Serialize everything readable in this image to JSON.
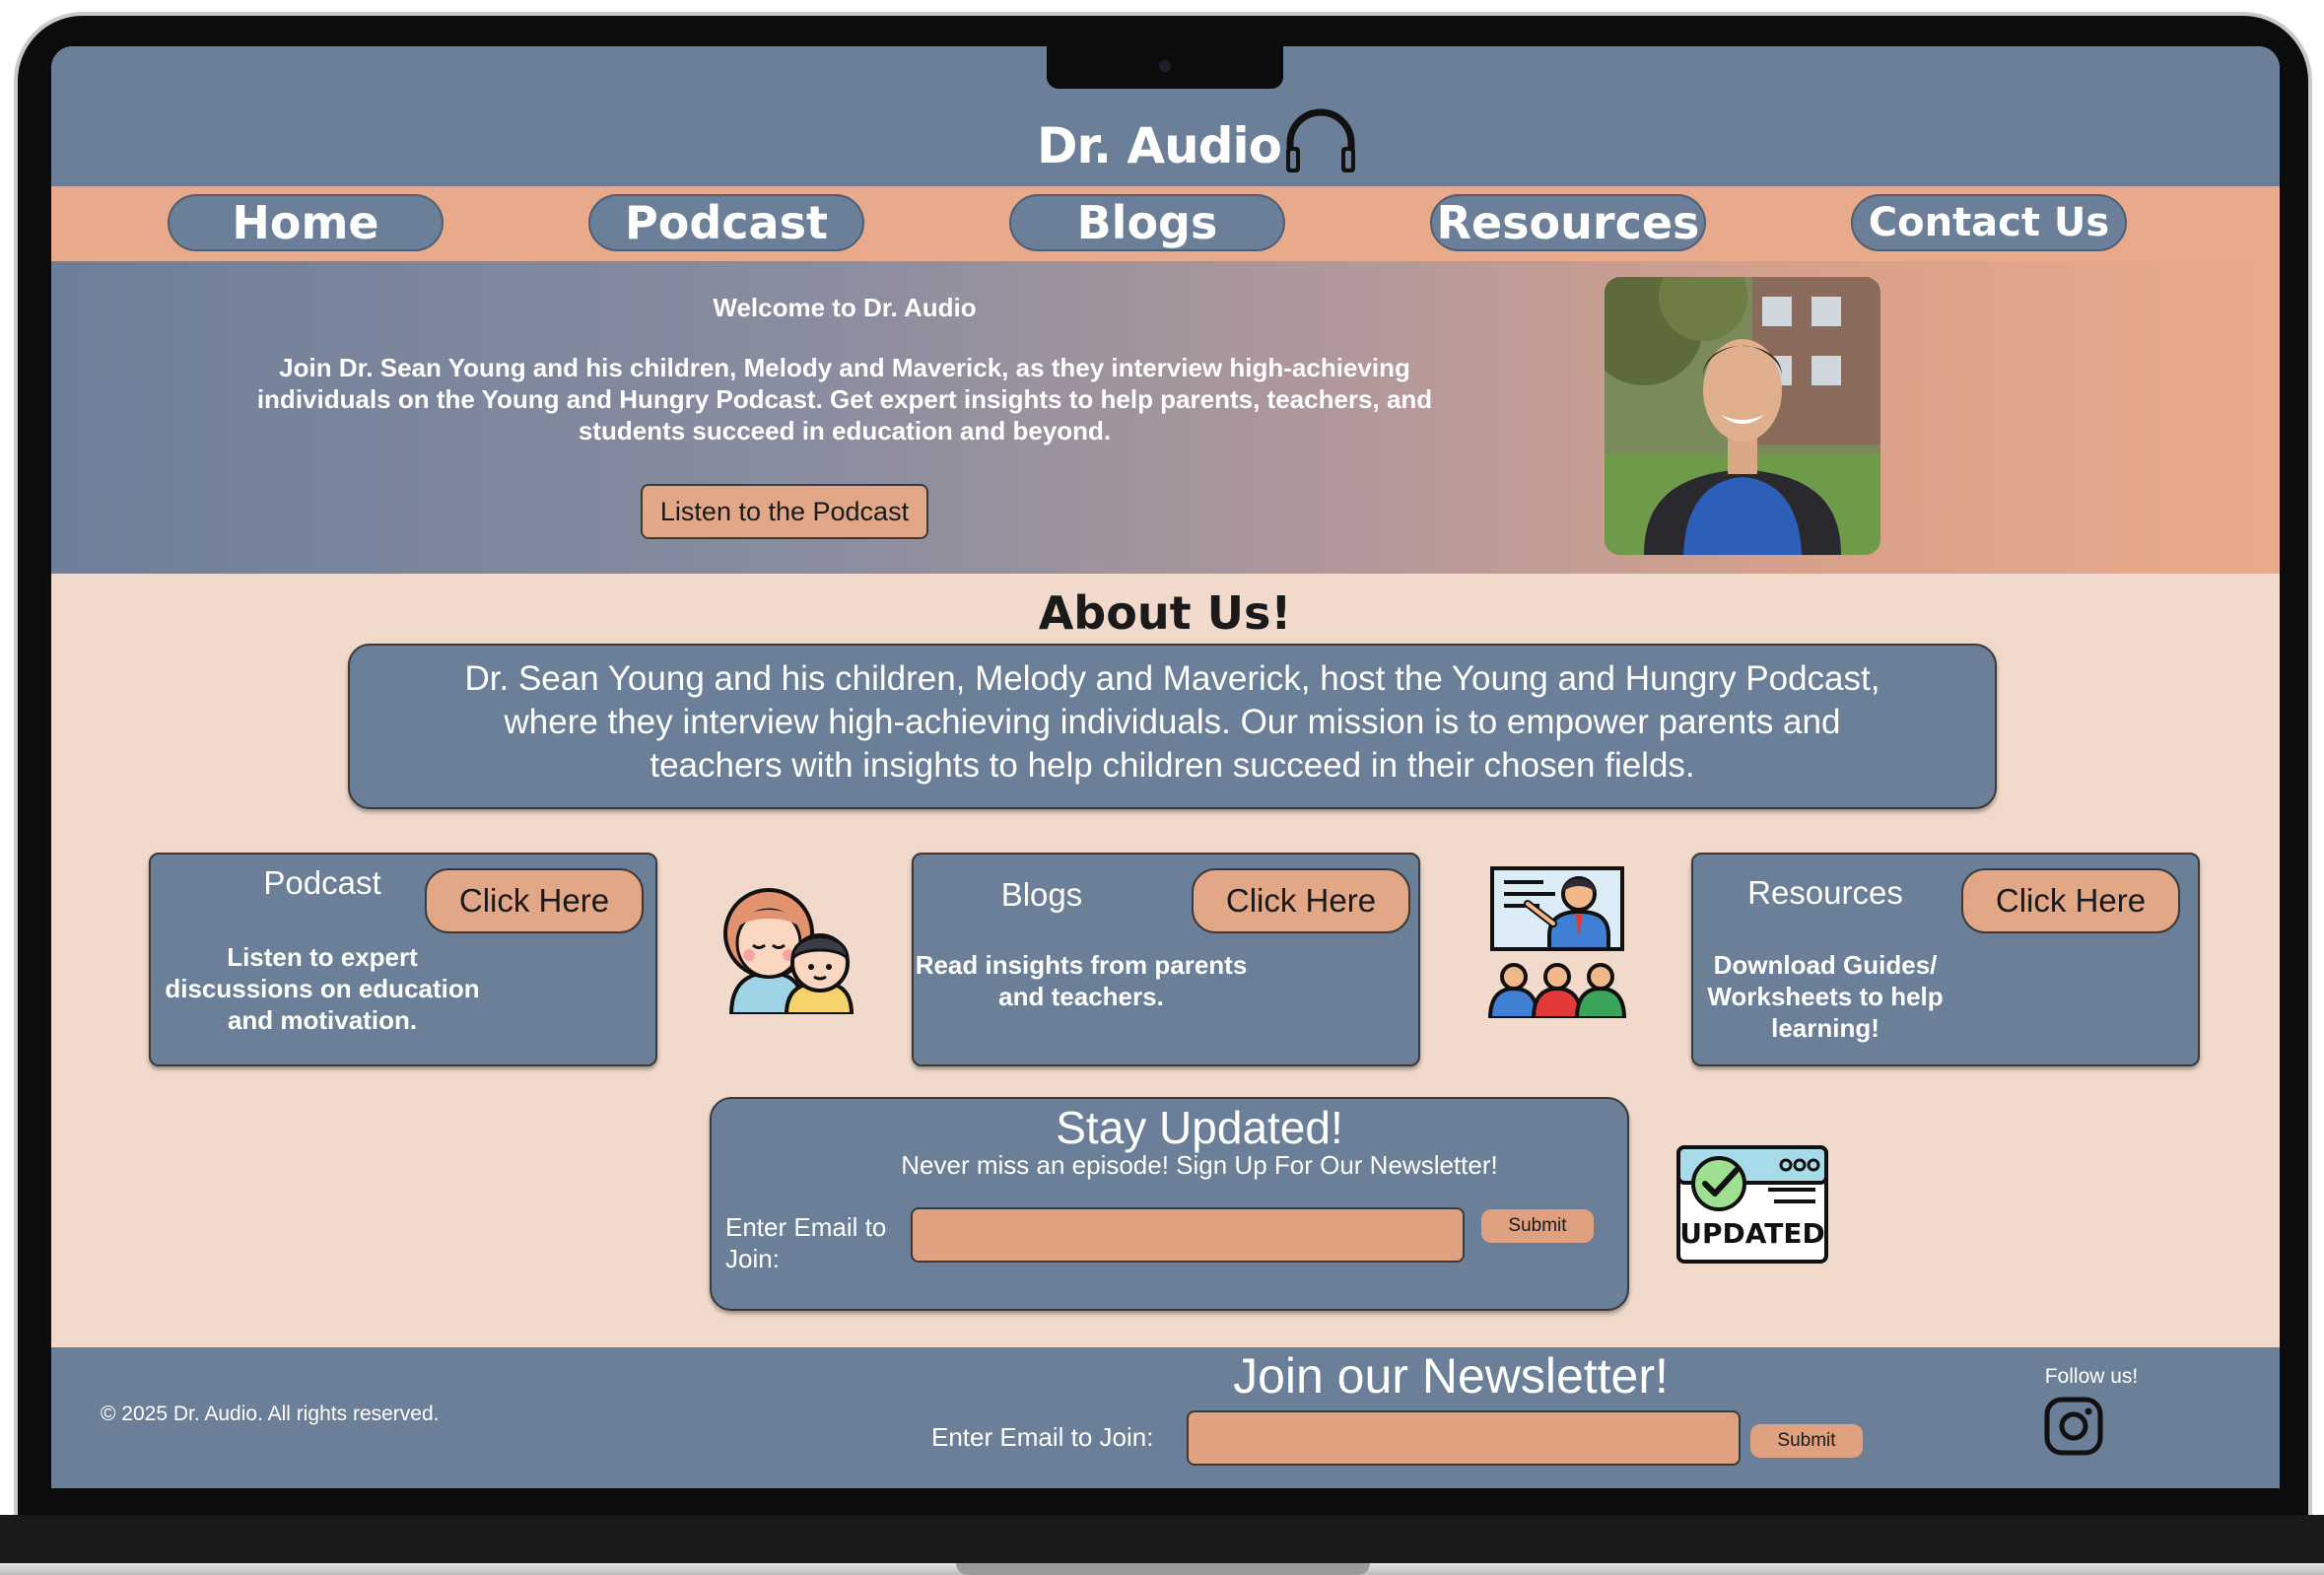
{
  "header": {
    "logo": "Dr. Audio",
    "logo_icon": "headphones-icon"
  },
  "nav": {
    "items": [
      {
        "label": "Home"
      },
      {
        "label": "Podcast"
      },
      {
        "label": "Blogs"
      },
      {
        "label": "Resources"
      },
      {
        "label": "Contact Us"
      }
    ]
  },
  "hero": {
    "title": "Welcome to Dr. Audio",
    "text": "Join Dr. Sean Young and his children, Melody and Maverick, as they interview high-achieving individuals on the Young and Hungry Podcast. Get expert insights to help parents, teachers, and students succeed in education and beyond.",
    "button": "Listen to the Podcast"
  },
  "about": {
    "title": "About Us!",
    "text": "Dr. Sean Young and his children, Melody and Maverick, host the Young and Hungry Podcast, where they interview high-achieving individuals. Our mission is to empower parents and teachers with insights to help children succeed in their chosen fields."
  },
  "cards": [
    {
      "title": "Podcast",
      "button": "Click Here",
      "text": "Listen to expert discussions on education and motivation."
    },
    {
      "title": "Blogs",
      "button": "Click Here",
      "text": "Read insights from parents and teachers."
    },
    {
      "title": "Resources",
      "button": "Click Here",
      "text": "Download Guides/ Worksheets to help learning!"
    }
  ],
  "stay": {
    "title": "Stay Updated!",
    "subtitle": "Never miss an episode! Sign Up For Our Newsletter!",
    "label": "Enter Email to Join:",
    "input_value": "",
    "submit": "Submit",
    "badge_text": "UPDATED"
  },
  "footer": {
    "copyright": "© 2025 Dr. Audio. All rights reserved.",
    "newsletter_title": "Join our Newsletter!",
    "label": "Enter Email to Join:",
    "input_value": "",
    "submit": "Submit",
    "follow": "Follow us!",
    "social_icon": "instagram-icon"
  },
  "colors": {
    "slate": "#6b7f99",
    "peach": "#e9aa8b",
    "cream": "#f1d9cc",
    "button": "#e2a786"
  }
}
